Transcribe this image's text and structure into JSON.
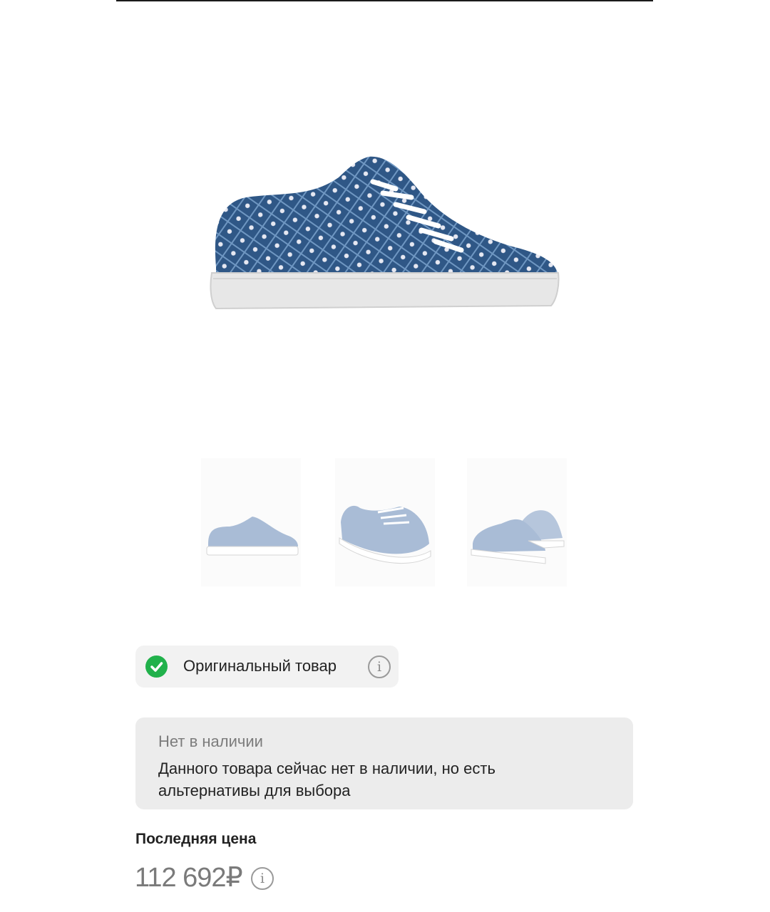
{
  "product": {
    "main_image_icon": "sneaker-image",
    "thumbnails": [
      {
        "icon": "sneaker-side-thumbnail"
      },
      {
        "icon": "sneaker-angle-thumbnail"
      },
      {
        "icon": "sneaker-back-thumbnail"
      }
    ]
  },
  "original_badge": {
    "label": "Оригинальный товар",
    "check_icon": "check-circle-icon",
    "info_icon": "info-icon",
    "info_glyph": "i",
    "check_color": "#21b14b"
  },
  "availability": {
    "title": "Нет в наличии",
    "text": "Данного товара сейчас нет в наличии, но есть альтернативы для выбора"
  },
  "price": {
    "label": "Последняя цена",
    "value": "112 692₽",
    "info_glyph": "i"
  }
}
